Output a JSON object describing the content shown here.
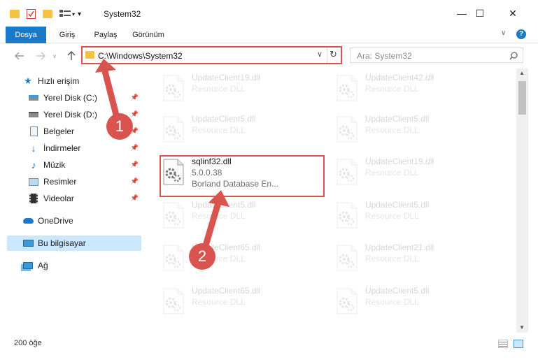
{
  "window": {
    "title": "System32",
    "controls": {
      "minimize": "—",
      "maximize": "☐",
      "close": "✕"
    }
  },
  "ribbon": {
    "tabs": [
      "Dosya",
      "Giriş",
      "Paylaş",
      "Görünüm"
    ],
    "active_tab": "Dosya"
  },
  "address_bar": {
    "path": "C:\\Windows\\System32",
    "search_placeholder": "Ara: System32"
  },
  "sidebar": {
    "items": [
      {
        "label": "Hızlı erişim",
        "icon": "star-icon",
        "pinned": false
      },
      {
        "label": "Yerel Disk (C:)",
        "icon": "drive-icon",
        "pinned": true
      },
      {
        "label": "Yerel Disk (D:)",
        "icon": "drive-icon",
        "pinned": true
      },
      {
        "label": "Belgeler",
        "icon": "document-icon",
        "pinned": true
      },
      {
        "label": "İndirmeler",
        "icon": "download-icon",
        "pinned": true
      },
      {
        "label": "Müzik",
        "icon": "music-icon",
        "pinned": true
      },
      {
        "label": "Resimler",
        "icon": "pictures-icon",
        "pinned": true
      },
      {
        "label": "Videolar",
        "icon": "video-icon",
        "pinned": true
      },
      {
        "label": "OneDrive",
        "icon": "cloud-icon",
        "pinned": false
      },
      {
        "label": "Bu bilgisayar",
        "icon": "computer-icon",
        "pinned": false,
        "selected": true
      },
      {
        "label": "Ağ",
        "icon": "network-icon",
        "pinned": false
      }
    ]
  },
  "files": {
    "left_column": [
      {
        "name": "UpdateClient19.dll",
        "line2": "Resource DLL"
      },
      {
        "name": "UpdateClient5.dll",
        "line2": "Resource DLL"
      },
      {
        "name": "sqlinf32.dll",
        "line2": "5.0.0.38",
        "line3": "Borland Database En...",
        "highlighted": true
      },
      {
        "name": "UpdateClient5.dll",
        "line2": "Resource DLL"
      },
      {
        "name": "UpdateClient65.dll",
        "line2": "Resource DLL"
      },
      {
        "name": "UpdateClient65.dll",
        "line2": "Resource DLL"
      }
    ],
    "right_column": [
      {
        "name": "UpdateClient42.dll",
        "line2": "Resource DLL"
      },
      {
        "name": "UpdateClient5.dll",
        "line2": "Resource DLL"
      },
      {
        "name": "UpdateClient19.dll",
        "line2": "Resource DLL"
      },
      {
        "name": "UpdateClient5.dll",
        "line2": "Resource DLL"
      },
      {
        "name": "UpdateClient21.dll",
        "line2": "Resource DLL"
      },
      {
        "name": "UpdateClient5.dll",
        "line2": "Resource DLL"
      }
    ]
  },
  "status_bar": {
    "item_count": "200 öğe"
  },
  "callouts": {
    "first": "1",
    "second": "2"
  },
  "colors": {
    "accent": "#1979ca",
    "highlight": "#d9534f",
    "selected_bg": "#cce8ff"
  }
}
